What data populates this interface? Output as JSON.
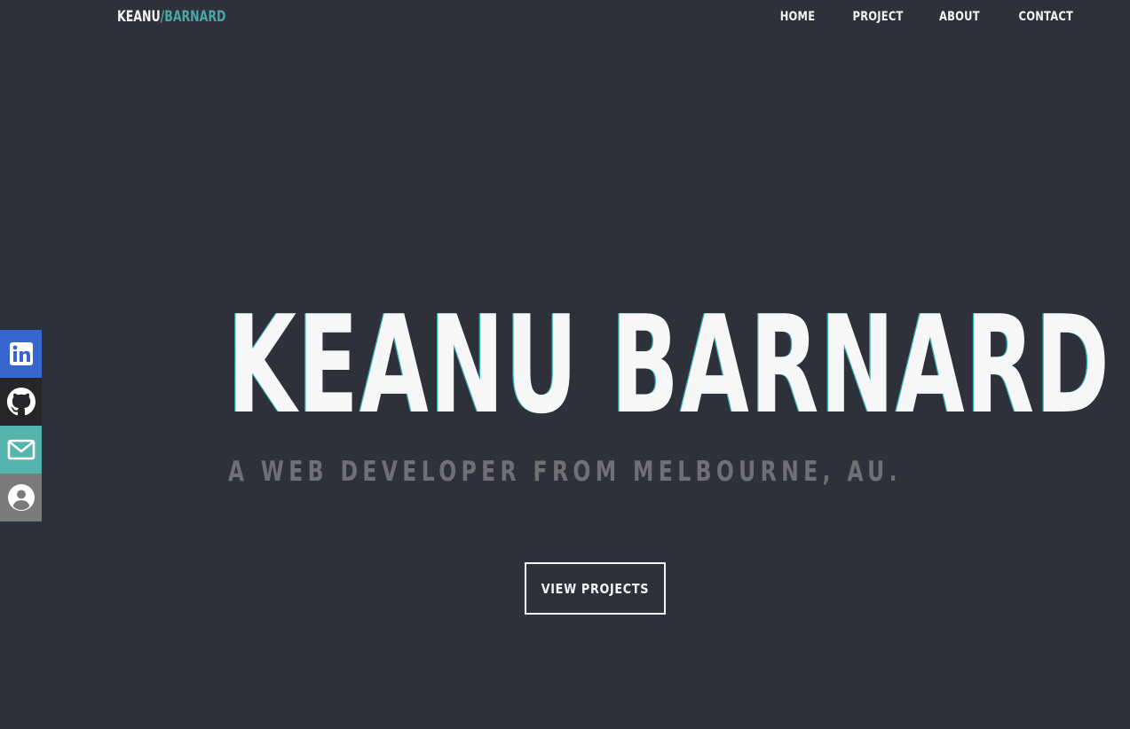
{
  "header": {
    "logo_first": "KEANU",
    "logo_separator": "/",
    "logo_last": "BARNARD",
    "nav": [
      "HOME",
      "PROJECT",
      "ABOUT",
      "CONTACT"
    ]
  },
  "social": [
    {
      "name": "linkedin",
      "icon": "linkedin-icon",
      "color": "#3866cf"
    },
    {
      "name": "github",
      "icon": "github-icon",
      "color": "#262629"
    },
    {
      "name": "email",
      "icon": "mail-icon",
      "color": "#55b4ad"
    },
    {
      "name": "profile",
      "icon": "user-icon",
      "color": "#7b7b7b"
    }
  ],
  "hero": {
    "title": "KEANU BARNARD",
    "subtitle": "A WEB DEVELOPER FROM MELBOURNE, AU.",
    "cta_label": "VIEW PROJECTS"
  },
  "colors": {
    "background": "#2f313a",
    "accent": "#4aa8a4",
    "text": "#f4f4f4",
    "subtitle": "#707074"
  }
}
